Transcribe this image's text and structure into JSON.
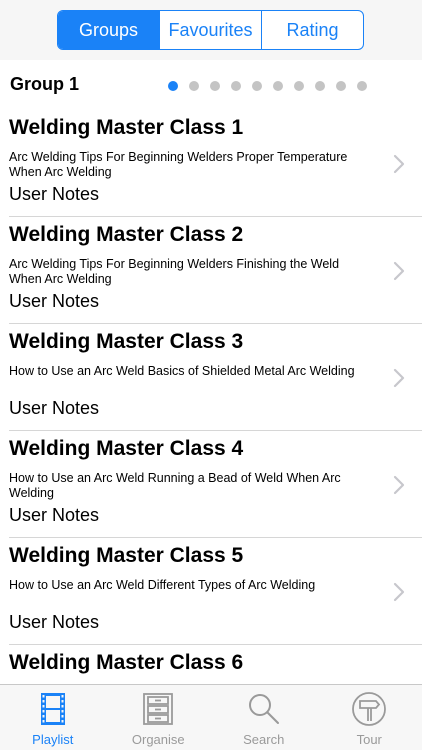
{
  "segmented_control": {
    "segments": [
      {
        "label": "Groups",
        "active": true
      },
      {
        "label": "Favourites",
        "active": false
      },
      {
        "label": "Rating",
        "active": false
      }
    ]
  },
  "group": {
    "title": "Group 1",
    "page_count": 10,
    "current_page": 1
  },
  "items": [
    {
      "title": "Welding Master Class 1",
      "description": "Arc Welding Tips For Beginning Welders  Proper Temperature When Arc Welding",
      "notes": "User Notes"
    },
    {
      "title": "Welding Master Class 2",
      "description": "Arc Welding Tips For Beginning Welders  Finishing the Weld When Arc Welding",
      "notes": "User Notes"
    },
    {
      "title": "Welding Master Class 3",
      "description": "How to Use an Arc Weld  Basics of Shielded Metal Arc Welding",
      "notes": "User Notes"
    },
    {
      "title": "Welding Master Class 4",
      "description": "How to Use an Arc Weld  Running a Bead of Weld When Arc Welding",
      "notes": "User Notes"
    },
    {
      "title": "Welding Master Class 5",
      "description": "How to Use an Arc Weld  Different Types of Arc Welding",
      "notes": "User Notes"
    },
    {
      "title": "Welding Master Class 6",
      "description": "",
      "notes": ""
    }
  ],
  "tabbar": {
    "tabs": [
      {
        "label": "Playlist",
        "icon": "film-strip-icon",
        "active": true
      },
      {
        "label": "Organise",
        "icon": "cabinet-icon",
        "active": false
      },
      {
        "label": "Search",
        "icon": "search-icon",
        "active": false
      },
      {
        "label": "Tour",
        "icon": "signpost-icon",
        "active": false
      }
    ]
  },
  "colors": {
    "accent": "#1a82f7",
    "inactive_tab": "#9a9a9a",
    "dot_inactive": "#c4c4c4",
    "chevron": "#c7c7cc"
  }
}
